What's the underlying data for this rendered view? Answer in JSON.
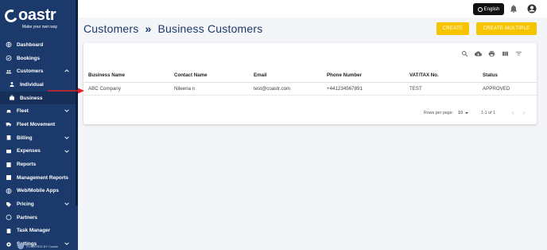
{
  "brand": {
    "name": "oastr",
    "tagline": "Make your own way"
  },
  "sidebar": {
    "items": [
      {
        "label": "Dashboard",
        "icon": "globe-icon"
      },
      {
        "label": "Bookings",
        "icon": "check-circle-icon"
      },
      {
        "label": "Customers",
        "icon": "users-icon",
        "expanded": true
      },
      {
        "label": "Individual",
        "icon": "person-icon",
        "sub": true
      },
      {
        "label": "Business",
        "icon": "briefcase-icon",
        "sub": true,
        "active": true
      },
      {
        "label": "Fleet",
        "icon": "car-icon"
      },
      {
        "label": "Fleet Movement",
        "icon": "truck-icon"
      },
      {
        "label": "Billing",
        "icon": "receipt-icon"
      },
      {
        "label": "Expenses",
        "icon": "wallet-icon"
      },
      {
        "label": "Reports",
        "icon": "report-icon"
      },
      {
        "label": "Management Reports",
        "icon": "chart-icon"
      },
      {
        "label": "Web/Mobile Apps",
        "icon": "globe-icon"
      },
      {
        "label": "Pricing",
        "icon": "tag-icon"
      },
      {
        "label": "Partners",
        "icon": "handshake-icon"
      },
      {
        "label": "Task Manager",
        "icon": "clipboard-icon"
      },
      {
        "label": "Settings",
        "icon": "gear-icon"
      }
    ],
    "powered_by": "POWERED BY Coastr"
  },
  "topbar": {
    "language": "English"
  },
  "header": {
    "crumb1": "Customers",
    "separator": "»",
    "crumb2": "Business Customers",
    "create_label": "CREATE",
    "create_multiple_label": "CREATE MULTIPLE"
  },
  "table": {
    "columns": [
      "Business Name",
      "Contact Name",
      "Email",
      "Phone Number",
      "VAT/TAX No.",
      "Status"
    ],
    "rows": [
      [
        "ABC Company",
        "Nileena n",
        "test@coastr.com",
        "+441234567891",
        "TEST",
        "APPROVED"
      ]
    ]
  },
  "pagination": {
    "rows_per_page_label": "Rows per page:",
    "rows_per_page": "10",
    "range": "1-1 of 1"
  },
  "colors": {
    "sidebar": "#1b3a6b",
    "accent": "#f7c500",
    "annotation": "#e02020"
  }
}
